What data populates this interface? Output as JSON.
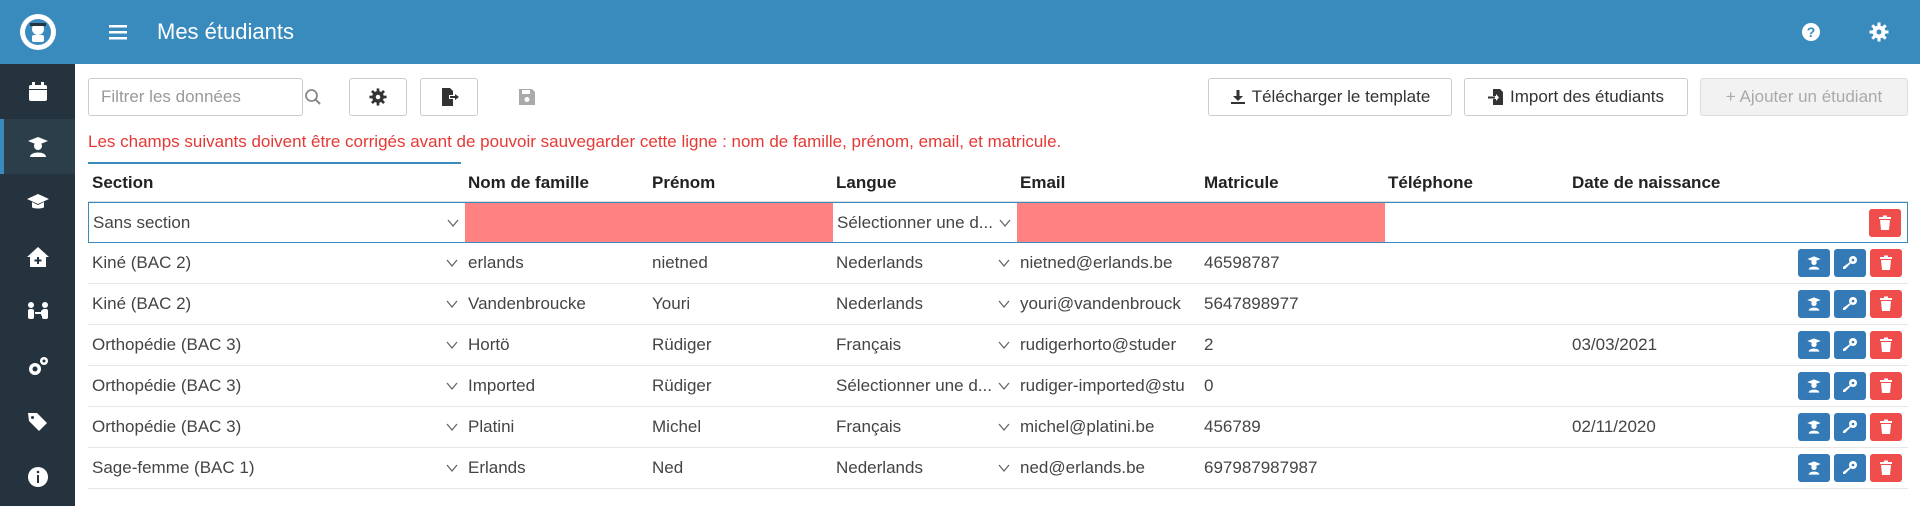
{
  "header": {
    "title": "Mes étudiants"
  },
  "sidebar": {
    "items": [
      {
        "icon": "calendar-icon"
      },
      {
        "icon": "student-icon",
        "active": true
      },
      {
        "icon": "graduation-cap-icon"
      },
      {
        "icon": "home-plus-icon"
      },
      {
        "icon": "people-exchange-icon"
      },
      {
        "icon": "gears-icon"
      },
      {
        "icon": "tags-icon"
      },
      {
        "icon": "info-icon"
      }
    ]
  },
  "toolbar": {
    "filter_placeholder": "Filtrer les données",
    "download_template": "Télécharger le template",
    "import_students": "Import des étudiants",
    "add_student": "+ Ajouter un étudiant"
  },
  "error_message": "Les champs suivants doivent être corrigés avant de pouvoir sauvegarder cette ligne : nom de famille, prénom, email, et matricule.",
  "table": {
    "columns": [
      "Section",
      "Nom de famille",
      "Prénom",
      "Langue",
      "Email",
      "Matricule",
      "Téléphone",
      "Date de naissance"
    ],
    "edit_row": {
      "section": "Sans section",
      "langue": "Sélectionner une d..."
    },
    "rows": [
      {
        "section": "Kiné (BAC 2)",
        "nom": "erlands",
        "prenom": "nietned",
        "langue": "Nederlands",
        "email": "nietned@erlands.be",
        "matricule": "46598787",
        "telephone": "",
        "date": ""
      },
      {
        "section": "Kiné (BAC 2)",
        "nom": "Vandenbroucke",
        "prenom": "Youri",
        "langue": "Nederlands",
        "email": "youri@vandenbrouck",
        "matricule": "5647898977",
        "telephone": "",
        "date": ""
      },
      {
        "section": "Orthopédie (BAC 3)",
        "nom": "Hortö",
        "prenom": "Rüdiger",
        "langue": "Français",
        "email": "rudigerhorto@studer",
        "matricule": "2",
        "telephone": "",
        "date": "03/03/2021"
      },
      {
        "section": "Orthopédie (BAC 3)",
        "nom": "Imported",
        "prenom": "Rüdiger",
        "langue": "Sélectionner une d...",
        "email": "rudiger-imported@stu",
        "matricule": "0",
        "telephone": "",
        "date": ""
      },
      {
        "section": "Orthopédie (BAC 3)",
        "nom": "Platini",
        "prenom": "Michel",
        "langue": "Français",
        "email": "michel@platini.be",
        "matricule": "456789",
        "telephone": "",
        "date": "02/11/2020"
      },
      {
        "section": "Sage-femme (BAC 1)",
        "nom": "Erlands",
        "prenom": "Ned",
        "langue": "Nederlands",
        "email": "ned@erlands.be",
        "matricule": "697987987987",
        "telephone": "",
        "date": ""
      }
    ]
  },
  "colors": {
    "primary": "#3a8bbd",
    "sidebar": "#24333d",
    "danger": "#ef4c4c",
    "invalid": "#ff8282",
    "action": "#337ab7"
  }
}
